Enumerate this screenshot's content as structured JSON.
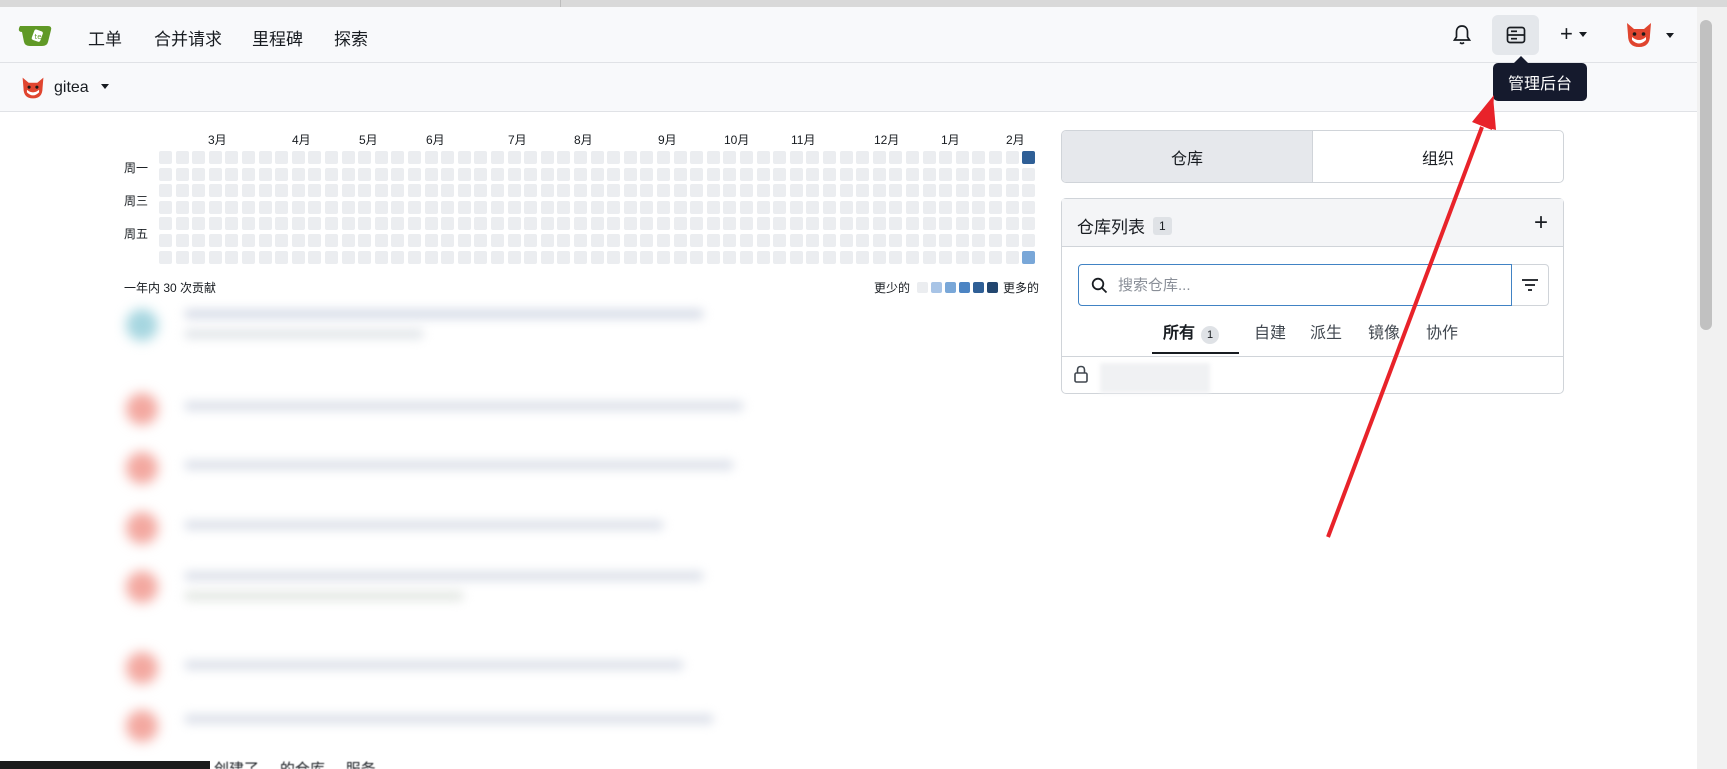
{
  "navbar": {
    "items": [
      "工单",
      "合并请求",
      "里程碑",
      "探索"
    ]
  },
  "context": {
    "name": "gitea"
  },
  "tooltip": "管理后台",
  "heatmap": {
    "months": [
      "3月",
      "4月",
      "5月",
      "6月",
      "7月",
      "8月",
      "9月",
      "10月",
      "11月",
      "12月",
      "1月",
      "2月"
    ],
    "days": [
      "周一",
      "周三",
      "周五"
    ],
    "total": "一年内 30 次贡献",
    "less": "更少的",
    "more": "更多的",
    "colors": [
      "#ebedf0",
      "#a8c4e6",
      "#79a7d8",
      "#4c84c3",
      "#2f5f96",
      "#22466f"
    ]
  },
  "tabs": [
    "仓库",
    "组织"
  ],
  "repo_panel": {
    "title": "仓库列表",
    "count": "1",
    "search_placeholder": "搜索仓库...",
    "subtabs": [
      "所有",
      "自建",
      "派生",
      "镜像",
      "协作"
    ],
    "all_count": "1"
  },
  "bottom_text": "创建了 ... 的仓库 ... 服务"
}
